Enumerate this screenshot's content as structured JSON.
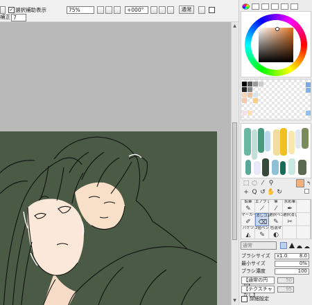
{
  "toolbar": {
    "show_selection_label": "選択補助表示",
    "zoom_value": "75%",
    "rotation_value": "+000°",
    "blend_label": "通常",
    "correction_label": "補正",
    "correction_value": "7"
  },
  "panel": {
    "tools_row2_glyphs": [
      "+",
      "Q",
      "↺",
      "✋",
      "↻"
    ],
    "brush_tools": [
      {
        "label": "鉛筆",
        "icon": "pencil-icon"
      },
      {
        "label": "エアブラシ",
        "icon": "airbrush-icon"
      },
      {
        "label": "筆",
        "icon": "brush-icon"
      },
      {
        "label": "水彩筆",
        "icon": "watercolor-icon"
      },
      {
        "label": "",
        "icon": ""
      },
      {
        "label": "マーカー",
        "icon": "marker-icon"
      },
      {
        "label": "消しゴム",
        "icon": "eraser-icon"
      },
      {
        "label": "選択ペン",
        "icon": "select-pen-icon"
      },
      {
        "label": "選択消し",
        "icon": "select-erase-icon"
      },
      {
        "label": "",
        "icon": ""
      },
      {
        "label": "バケツ",
        "icon": "bucket-icon"
      },
      {
        "label": "2値ペン",
        "icon": "binary-pen-icon"
      },
      {
        "label": "色混ぜ",
        "icon": "blend-icon"
      },
      {
        "label": "",
        "icon": ""
      },
      {
        "label": "",
        "icon": ""
      }
    ],
    "mode_label": "通常",
    "brush_size_label": "ブラシサイズ",
    "brush_size_mult": "x1.0",
    "brush_size_value": "8.0",
    "min_size_label": "最小サイズ",
    "min_size_value": "0%",
    "density_label": "ブラシ濃度",
    "density_value": "100",
    "shape_select": "【通常の円形】",
    "shape_value": "50",
    "texture_select": "【テクスチャなし】",
    "texture_value": "95",
    "detail_label": "詳細設定"
  },
  "colors": {
    "canvas_bg": "#4a5a44",
    "selected_color": "#f4b07a",
    "accent": "#6b8cc4"
  }
}
